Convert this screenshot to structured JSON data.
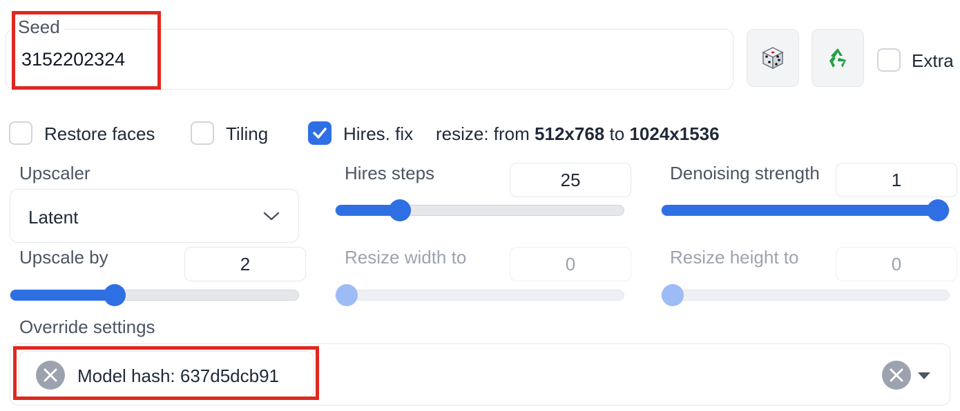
{
  "seed": {
    "label": "Seed",
    "value": "3152202324",
    "extra_label": "Extra",
    "extra_checked": false
  },
  "options": {
    "restore_faces": {
      "label": "Restore faces",
      "checked": false
    },
    "tiling": {
      "label": "Tiling",
      "checked": false
    },
    "hires_fix": {
      "label": "Hires. fix",
      "checked": true
    },
    "resize_prefix": "resize: from",
    "resize_from": "512x768",
    "resize_to_word": "to",
    "resize_to": "1024x1536"
  },
  "upscaler": {
    "label": "Upscaler",
    "value": "Latent"
  },
  "hires_steps": {
    "label": "Hires steps",
    "value": "25",
    "slider_fraction": 0.2
  },
  "denoising": {
    "label": "Denoising strength",
    "value": "1",
    "slider_fraction": 1.0
  },
  "upscale_by": {
    "label": "Upscale by",
    "value": "2",
    "slider_fraction": 0.35
  },
  "resize_width": {
    "label": "Resize width to",
    "value": "0",
    "slider_fraction": 0.0
  },
  "resize_height": {
    "label": "Resize height to",
    "value": "0",
    "slider_fraction": 0.0
  },
  "override": {
    "label": "Override settings",
    "tag": "Model hash: 637d5dcb91"
  },
  "colors": {
    "accent": "#2f6fe4",
    "highlight": "#e0281f"
  }
}
